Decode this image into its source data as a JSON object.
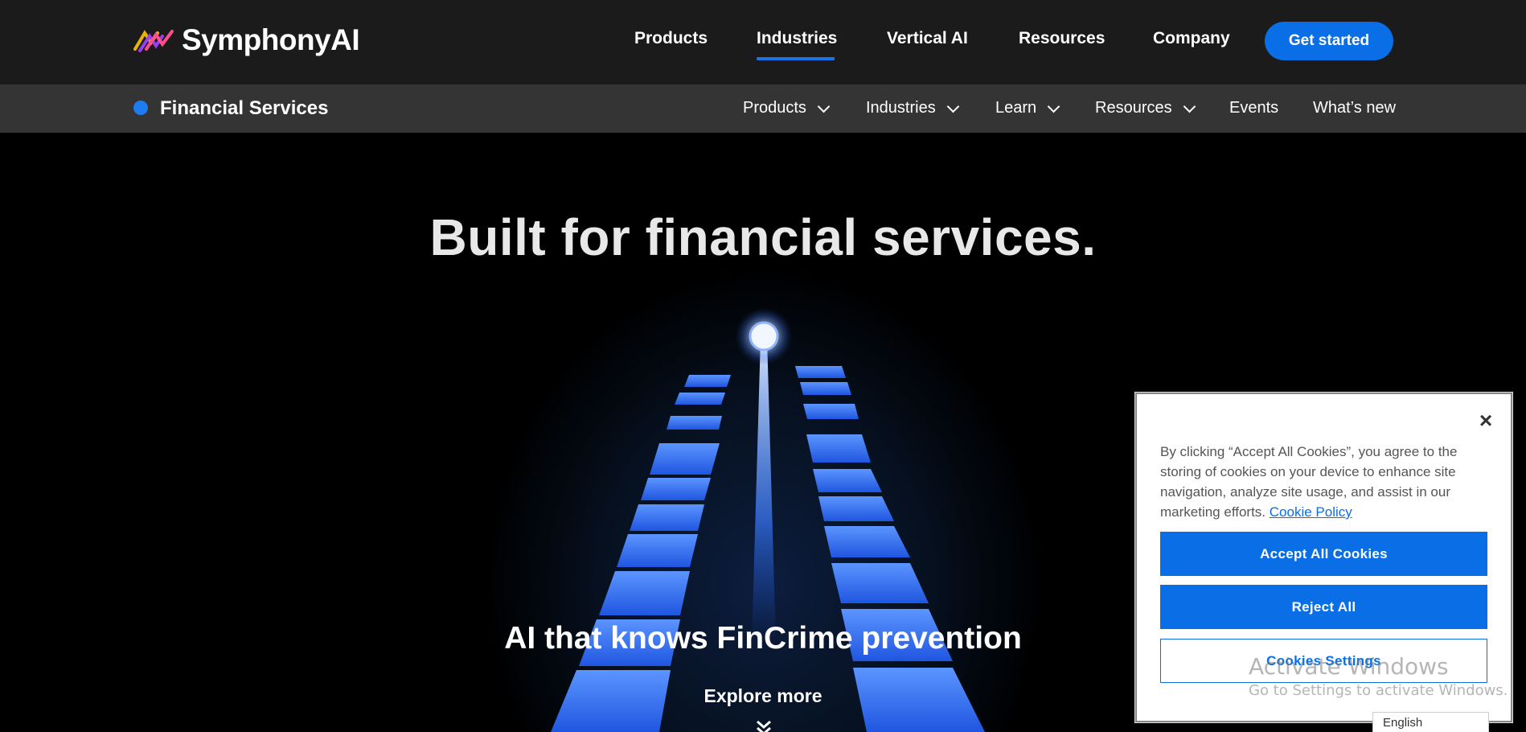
{
  "brand": {
    "name": "SymphonyAI"
  },
  "topnav": {
    "items": [
      {
        "label": "Products"
      },
      {
        "label": "Industries",
        "active": true
      },
      {
        "label": "Vertical AI"
      },
      {
        "label": "Resources"
      },
      {
        "label": "Company"
      }
    ],
    "cta": "Get started"
  },
  "subnav": {
    "title": "Financial Services",
    "items": [
      {
        "label": "Products",
        "dropdown": true
      },
      {
        "label": "Industries",
        "dropdown": true
      },
      {
        "label": "Learn",
        "dropdown": true
      },
      {
        "label": "Resources",
        "dropdown": true
      },
      {
        "label": "Events",
        "dropdown": false
      },
      {
        "label": "What’s new",
        "dropdown": false
      }
    ]
  },
  "hero": {
    "title": "Built for financial services.",
    "subtitle": "AI that knows FinCrime prevention",
    "explore": "Explore more"
  },
  "cookie_banner": {
    "text": "By clicking “Accept All Cookies”, you agree to the storing of cookies on your device to enhance site navigation, analyze site usage, and assist in our marketing efforts.",
    "link": "Cookie Policy",
    "accept": "Accept All Cookies",
    "reject": "Reject All",
    "settings": "Cookies Settings"
  },
  "os_watermark": {
    "line1": "Activate Windows",
    "line2": "Go to Settings to activate Windows."
  },
  "language_selector": {
    "value": "English"
  },
  "colors": {
    "accent": "#0a6fe6",
    "topnav_bg": "#1b1b1b",
    "subnav_bg": "#343434",
    "hero_bg": "#000000"
  },
  "icons": [
    "symphonyai-logo-icon",
    "blue-dot-icon",
    "chevron-down-icon",
    "close-icon",
    "double-chevron-down-icon"
  ]
}
